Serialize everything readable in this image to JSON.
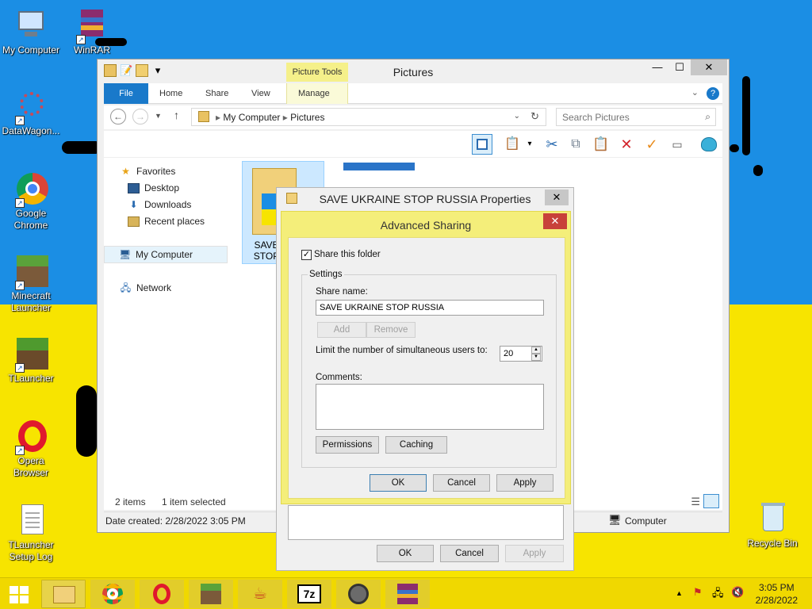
{
  "desktop": {
    "icons": [
      {
        "label": "My Computer"
      },
      {
        "label": "WinRAR"
      },
      {
        "label": "DataWagon..."
      },
      {
        "label": "Google Chrome"
      },
      {
        "label": "Minecraft Launcher"
      },
      {
        "label": "TLauncher"
      },
      {
        "label": "Opera Browser"
      },
      {
        "label": "TLauncher Setup Log"
      },
      {
        "label": "Recycle Bin"
      }
    ]
  },
  "explorer": {
    "title": "Pictures",
    "context_tab": "Picture Tools",
    "tabs": [
      "File",
      "Home",
      "Share",
      "View",
      "Manage"
    ],
    "breadcrumb": [
      "My Computer",
      "Pictures"
    ],
    "search_placeholder": "Search Pictures",
    "nav": {
      "favorites": "Favorites",
      "desktop": "Desktop",
      "downloads": "Downloads",
      "recent": "Recent places",
      "computer": "My Computer",
      "network": "Network"
    },
    "folder_label_line1": "SAVE",
    "folder_label_line2": "STOP",
    "status_items": "2 items",
    "status_selected": "1 item selected",
    "details_date": "Date created: 2/28/2022 3:05 PM",
    "details_location": "Computer"
  },
  "properties": {
    "title": "SAVE UKRAINE STOP RUSSIA Properties",
    "ok": "OK",
    "cancel": "Cancel",
    "apply": "Apply"
  },
  "advanced_sharing": {
    "title": "Advanced Sharing",
    "share_checkbox_label": "Share this folder",
    "share_checked": true,
    "settings_label": "Settings",
    "share_name_label": "Share name:",
    "share_name_value": "SAVE UKRAINE STOP RUSSIA",
    "add": "Add",
    "remove": "Remove",
    "limit_label": "Limit the number of simultaneous users to:",
    "limit_value": "20",
    "comments_label": "Comments:",
    "comments_value": "",
    "permissions": "Permissions",
    "caching": "Caching",
    "ok": "OK",
    "cancel": "Cancel",
    "apply": "Apply"
  },
  "taskbar": {
    "apps": [
      "file-explorer",
      "chrome",
      "opera",
      "minecraft",
      "java",
      "7-zip",
      "device",
      "winrar"
    ],
    "time": "3:05 PM",
    "date": "2/28/2022"
  },
  "colors": {
    "flag_blue": "#1b8ee4",
    "flag_yellow": "#f7e400",
    "file_tab": "#1979ca",
    "dialog_highlight": "#f4ee7a",
    "close_red": "#c8413a"
  }
}
